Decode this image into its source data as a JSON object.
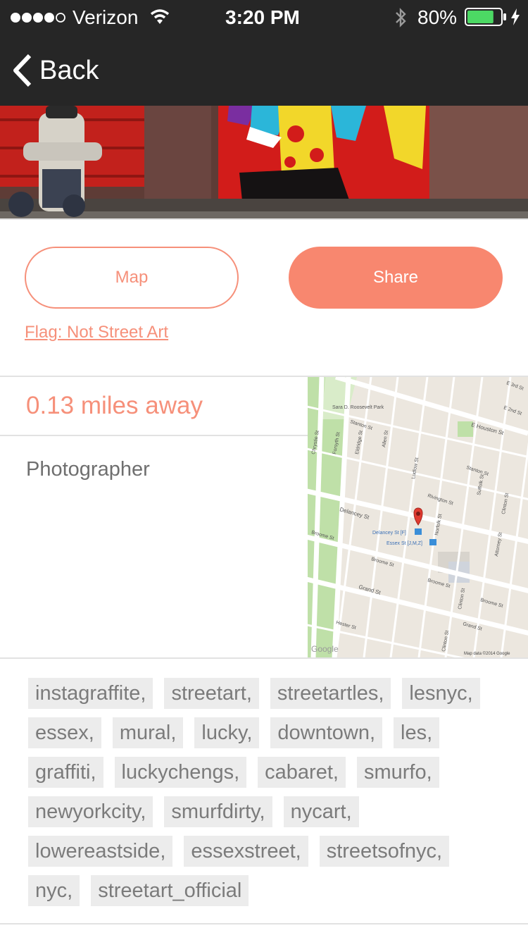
{
  "status_bar": {
    "carrier": "Verizon",
    "time": "3:20 PM",
    "battery": "80%",
    "signal_icon": "signal-dots-icon",
    "wifi_icon": "wifi-icon",
    "bluetooth_icon": "bluetooth-icon",
    "battery_icon": "battery-icon",
    "charging_icon": "charging-bolt-icon",
    "battery_level": 0.8,
    "battery_color": "#4cd964"
  },
  "nav": {
    "back_label": "Back",
    "back_icon": "chevron-left-icon"
  },
  "actions": {
    "map_label": "Map",
    "share_label": "Share",
    "flag_label": "Flag: Not Street Art"
  },
  "info": {
    "distance": "0.13 miles away",
    "photographer_label": "Photographer"
  },
  "map": {
    "streets": [
      "Sara D. Roosevelt Park",
      "E 3rd St",
      "E 2nd St",
      "E Houston St",
      "Chrystie St",
      "Forsyth St",
      "Stanton St",
      "Eldridge St",
      "Allen St",
      "Ludlow St",
      "Stanton St",
      "Suffolk St",
      "Clinton St",
      "Rivington St",
      "Norfolk St",
      "Delancey St",
      "Broome St",
      "Attorney St",
      "Broome St",
      "Broome St",
      "Grand St",
      "Clinton St",
      "Broome St",
      "Hester St",
      "Clinton St",
      "Grand St"
    ],
    "station_1": "Delancey St [F]",
    "station_2": "Essex St [J,M,Z]",
    "attribution": "Map data ©2014 Google",
    "google_logo": "Google",
    "pin_icon": "map-pin-icon",
    "colors": {
      "land": "#ece7df",
      "road": "#ffffff",
      "park": "#bfe0a8",
      "pin": "#e03a2f"
    }
  },
  "tags": [
    "instagraffite,",
    "streetart,",
    "streetartles,",
    "lesnyc,",
    "essex,",
    "mural,",
    "lucky,",
    "downtown,",
    "les,",
    "graffiti,",
    "luckychengs,",
    "cabaret,",
    "smurfo,",
    "newyorkcity,",
    "smurfdirty,",
    "nycart,",
    "lowereastside,",
    "essexstreet,",
    "streetsofnyc,",
    "nyc,",
    "streetart_official"
  ],
  "colors": {
    "accent": "#f8876f",
    "bar_bg": "#262626",
    "tag_bg": "#ececec",
    "tag_text": "#7b7b7b"
  }
}
